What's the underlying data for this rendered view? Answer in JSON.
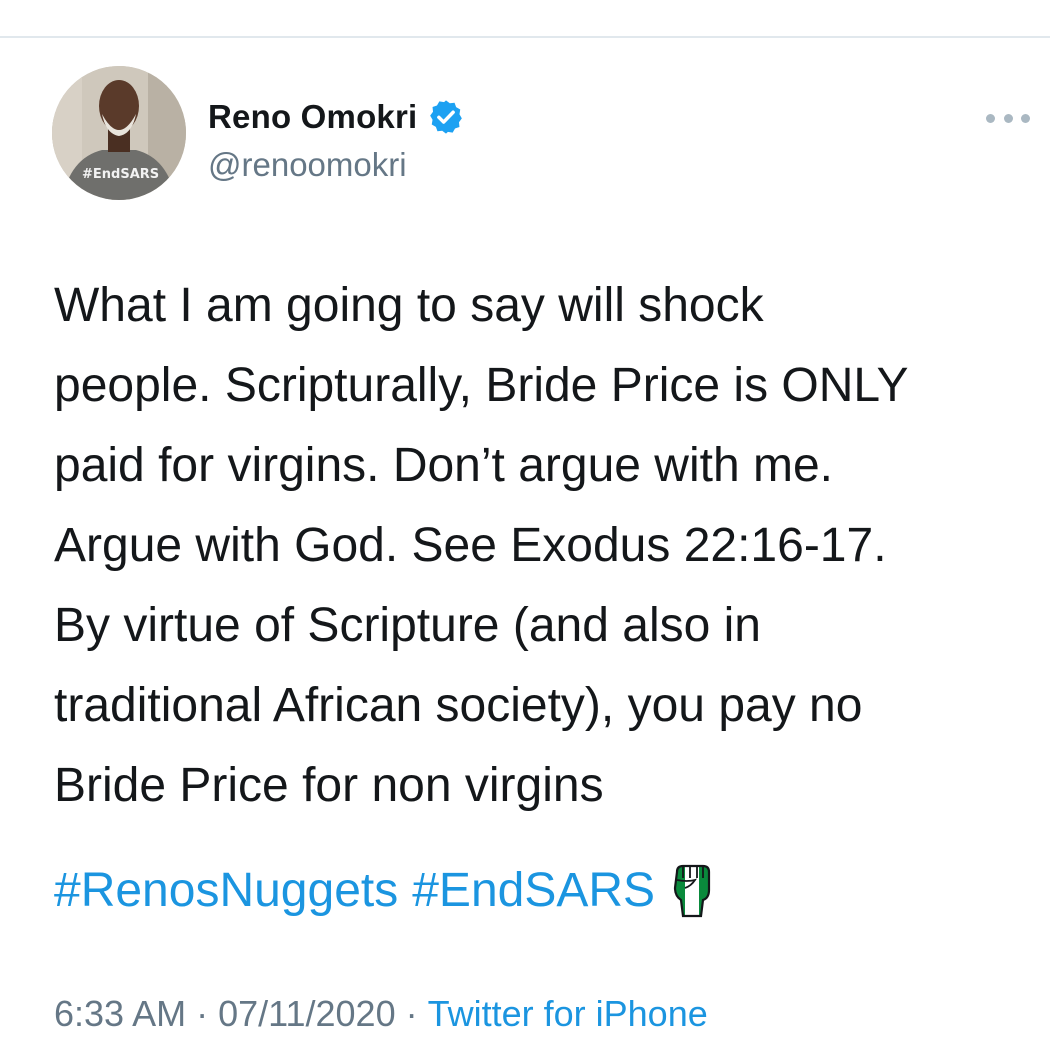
{
  "author": {
    "display_name": "Reno Omokri",
    "handle": "@renoomokri",
    "verified": true,
    "avatar_shirt_text": "#EndSARS"
  },
  "tweet": {
    "lines": [
      "What I am going to say will shock",
      "people. Scripturally, Bride Price is ONLY",
      "paid for virgins. Don’t argue with me.",
      "Argue with God. See Exodus 22:16-17.",
      "By virtue of Scripture (and also in",
      "traditional African society), you pay no",
      "Bride Price for non virgins"
    ],
    "hashtags": [
      "#RenosNuggets",
      "#EndSARS"
    ],
    "emoji": "raised-fist-nigeria-flag-icon"
  },
  "meta": {
    "time": "6:33 AM",
    "separator": "·",
    "date": "07/11/2020",
    "source": "Twitter for iPhone"
  },
  "colors": {
    "link": "#1b95e0",
    "secondary_text": "#657786",
    "primary_text": "#14171a",
    "verified": "#1da1f2",
    "divider": "#e1e8ed"
  },
  "icons": {
    "verified": "verified-badge-icon",
    "more": "more-icon"
  }
}
